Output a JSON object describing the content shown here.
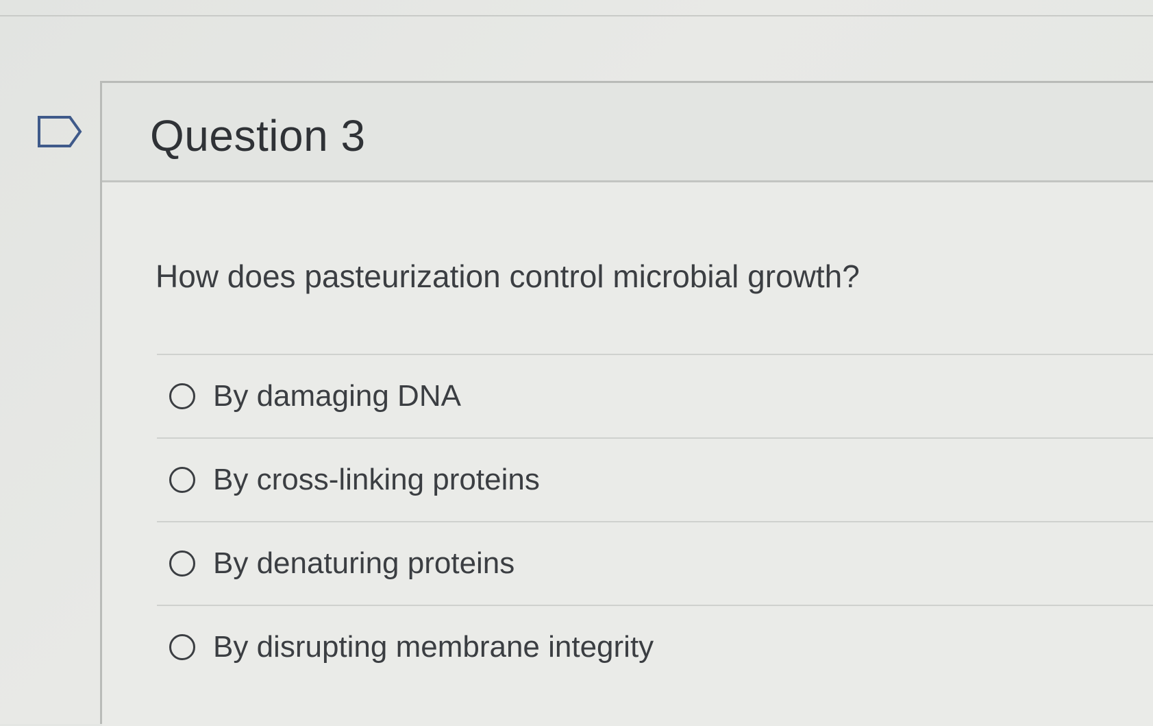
{
  "question": {
    "title": "Question 3",
    "text": "How does pasteurization control microbial growth?",
    "flag_icon": "flag-question-icon"
  },
  "answers": [
    {
      "label": "By damaging DNA",
      "selected": false
    },
    {
      "label": "By cross-linking proteins",
      "selected": false
    },
    {
      "label": "By denaturing proteins",
      "selected": false
    },
    {
      "label": "By disrupting membrane integrity",
      "selected": false
    }
  ]
}
